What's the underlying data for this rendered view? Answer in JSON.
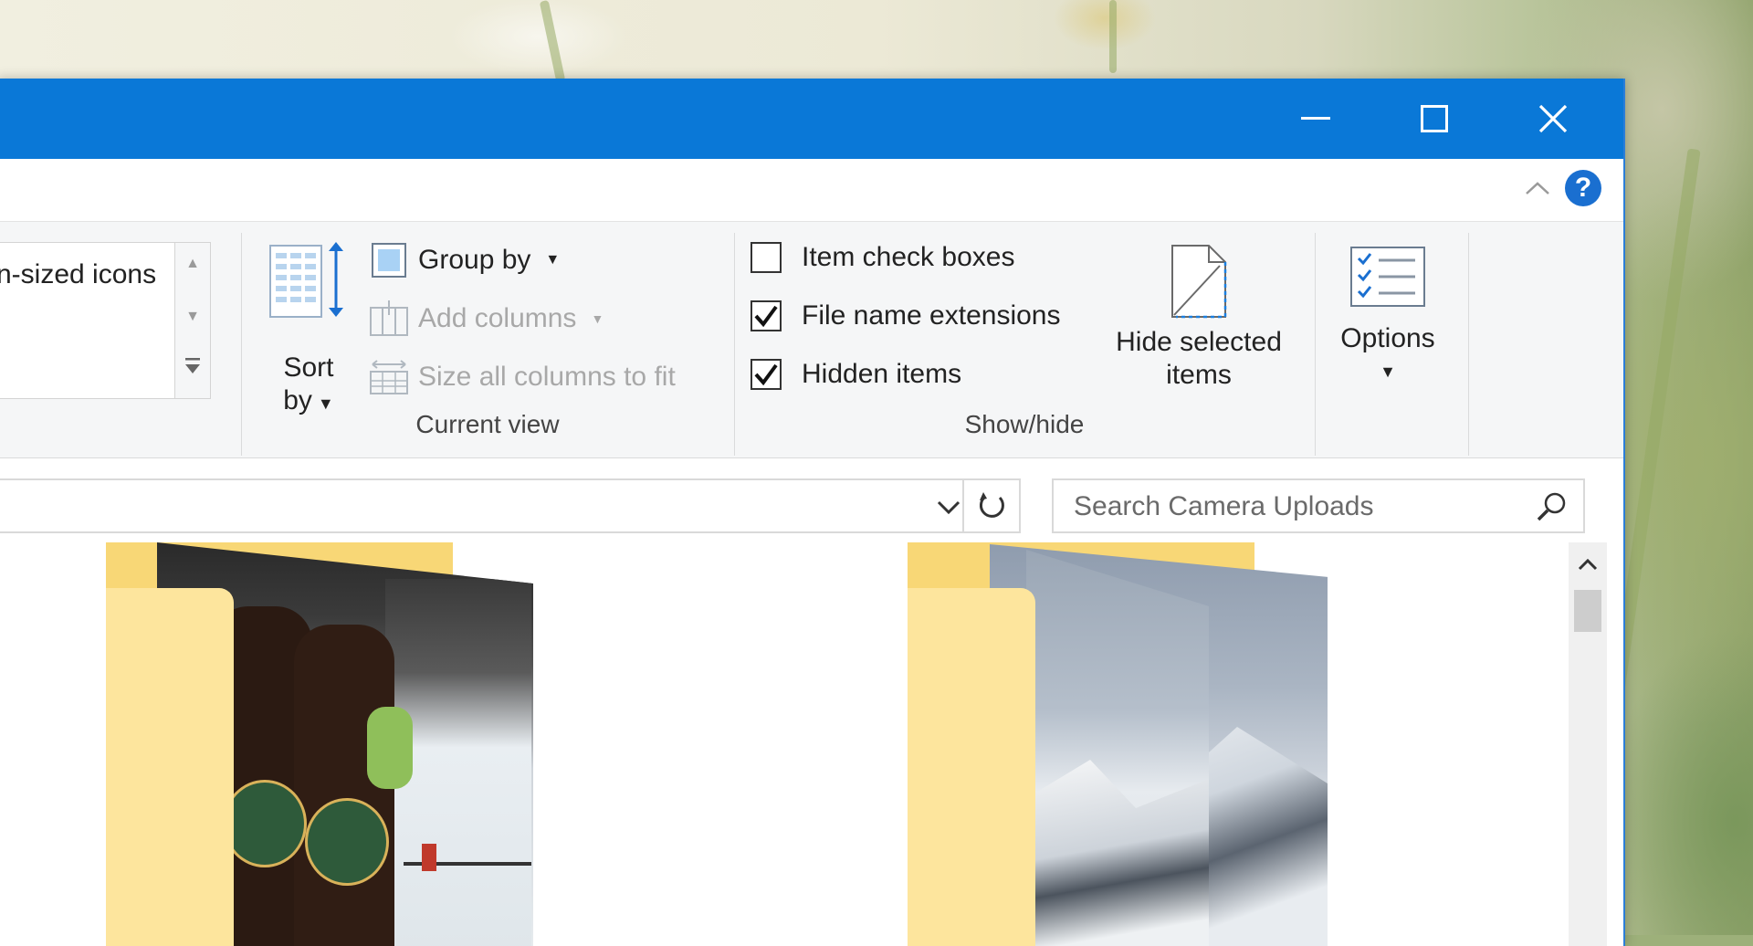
{
  "window": {
    "controls": {
      "minimize": "minimize",
      "maximize": "maximize",
      "close": "close"
    },
    "accent_color": "#0a78d7"
  },
  "ribbon": {
    "layout": {
      "selected_text": "n-sized icons"
    },
    "current_view": {
      "sort_by": {
        "line1": "Sort",
        "line2": "by"
      },
      "group_by": "Group by",
      "add_columns": "Add columns",
      "size_columns": "Size all columns to fit",
      "group_label": "Current view"
    },
    "show_hide": {
      "item_check_boxes": {
        "label": "Item check boxes",
        "checked": false
      },
      "file_name_extensions": {
        "label": "File name extensions",
        "checked": true
      },
      "hidden_items": {
        "label": "Hidden items",
        "checked": true
      },
      "hide_selected": {
        "line1": "Hide selected",
        "line2": "items"
      },
      "group_label": "Show/hide"
    },
    "options": {
      "label": "Options"
    },
    "help_label": "?"
  },
  "navigation": {
    "address_value": "",
    "search_placeholder": "Search Camera Uploads"
  },
  "content": {
    "folders": [
      {
        "name": "",
        "thumbnail": "bottles-and-ice-rink-photo"
      },
      {
        "name": "",
        "thumbnail": "snowy-mountains-photo"
      }
    ]
  }
}
